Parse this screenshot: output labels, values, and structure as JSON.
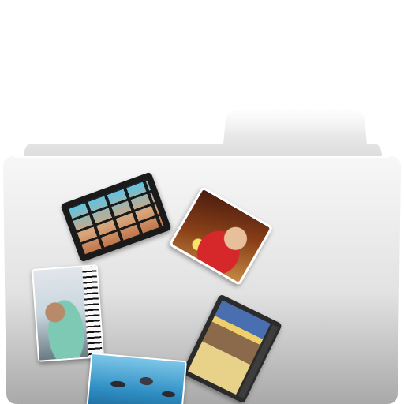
{
  "folder": {
    "icons": [
      "folder-icon"
    ],
    "colors": {
      "back": "#e3e3e3",
      "front_top": "#f2f2f2",
      "front_bottom": "#a8a8a8"
    }
  },
  "cards": [
    {
      "icon": "film-strip-icon"
    },
    {
      "icon": "birthday-photo-icon"
    },
    {
      "icon": "piano-photo-icon"
    },
    {
      "icon": "scrapbook-page-icon"
    },
    {
      "icon": "pool-photo-icon"
    }
  ]
}
